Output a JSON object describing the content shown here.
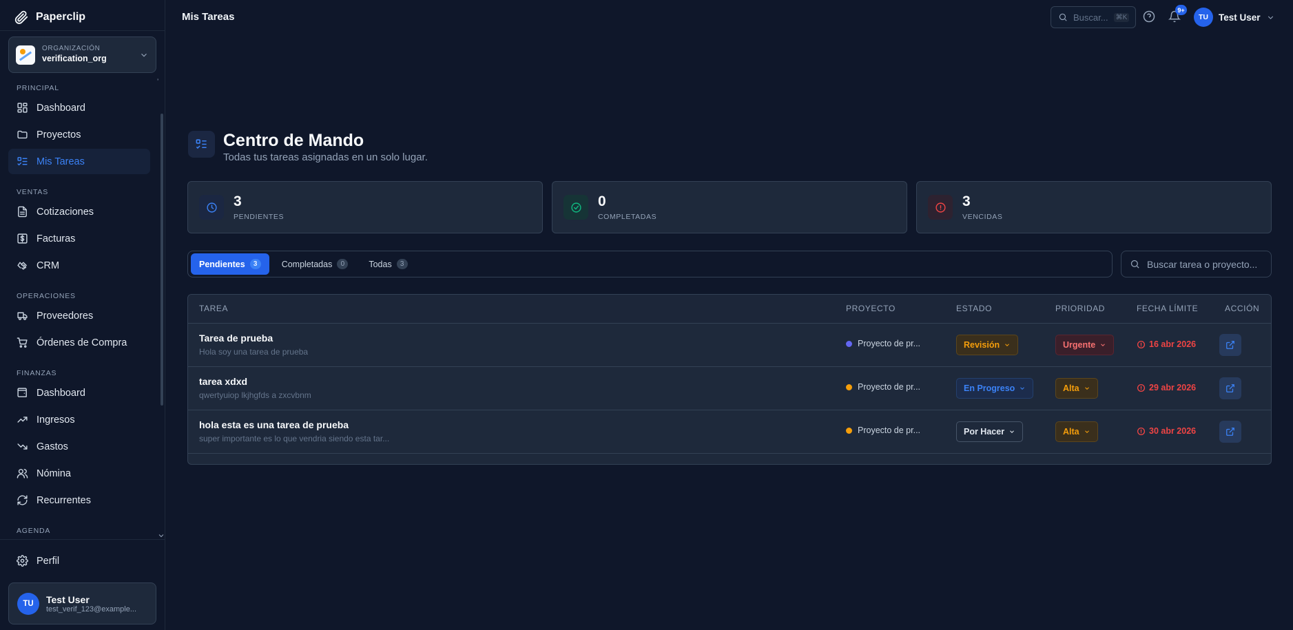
{
  "app": {
    "name": "Paperclip"
  },
  "org": {
    "label": "ORGANIZACIÓN",
    "name": "verification_org"
  },
  "sidebar": {
    "sections": [
      {
        "title": "PRINCIPAL",
        "items": [
          {
            "label": "Dashboard",
            "icon": "dashboard-icon"
          },
          {
            "label": "Proyectos",
            "icon": "folder-icon"
          },
          {
            "label": "Mis Tareas",
            "icon": "tasks-icon",
            "active": true
          }
        ]
      },
      {
        "title": "VENTAS",
        "items": [
          {
            "label": "Cotizaciones",
            "icon": "document-icon"
          },
          {
            "label": "Facturas",
            "icon": "dollar-icon"
          },
          {
            "label": "CRM",
            "icon": "handshake-icon"
          }
        ]
      },
      {
        "title": "OPERACIONES",
        "items": [
          {
            "label": "Proveedores",
            "icon": "truck-icon"
          },
          {
            "label": "Órdenes de Compra",
            "icon": "cart-icon"
          }
        ]
      },
      {
        "title": "FINANZAS",
        "items": [
          {
            "label": "Dashboard",
            "icon": "wallet-icon"
          },
          {
            "label": "Ingresos",
            "icon": "trend-up-icon"
          },
          {
            "label": "Gastos",
            "icon": "trend-down-icon"
          },
          {
            "label": "Nómina",
            "icon": "users-icon"
          },
          {
            "label": "Recurrentes",
            "icon": "refresh-icon"
          }
        ]
      },
      {
        "title": "AGENDA",
        "items": []
      }
    ],
    "perfil": "Perfil",
    "user": {
      "initials": "TU",
      "name": "Test User",
      "email": "test_verif_123@example..."
    }
  },
  "topbar": {
    "title": "Mis Tareas",
    "search_placeholder": "Buscar...",
    "shortcut": "⌘K",
    "notifications_badge": "9+",
    "user": {
      "initials": "TU",
      "name": "Test User"
    }
  },
  "page": {
    "title": "Centro de Mando",
    "subtitle": "Todas tus tareas asignadas en un solo lugar."
  },
  "stats": [
    {
      "value": "3",
      "label": "PENDIENTES",
      "icon": "clock-icon",
      "color": "#3b82f6",
      "bg": "#1b2742"
    },
    {
      "value": "0",
      "label": "COMPLETADAS",
      "icon": "check-circle-icon",
      "color": "#10b981",
      "bg": "#163436"
    },
    {
      "value": "3",
      "label": "VENCIDAS",
      "icon": "alert-circle-icon",
      "color": "#ef4444",
      "bg": "#2d2230"
    }
  ],
  "tabs": [
    {
      "label": "Pendientes",
      "count": "3",
      "active": true
    },
    {
      "label": "Completadas",
      "count": "0"
    },
    {
      "label": "Todas",
      "count": "3"
    }
  ],
  "task_search_placeholder": "Buscar tarea o proyecto...",
  "table": {
    "headers": {
      "task": "TAREA",
      "project": "PROYECTO",
      "state": "ESTADO",
      "priority": "PRIORIDAD",
      "due": "FECHA LÍMITE",
      "action": "ACCIÓN"
    },
    "rows": [
      {
        "name": "Tarea de prueba",
        "desc": "Hola soy una tarea de prueba",
        "project": "Proyecto de pr...",
        "project_color": "#6366f1",
        "state": "Revisión",
        "state_style": "amber",
        "priority": "Urgente",
        "priority_style": "red",
        "due": "16 abr 2026"
      },
      {
        "name": "tarea xdxd",
        "desc": "qwertyuiop lkjhgfds a zxcvbnm",
        "project": "Proyecto de pr...",
        "project_color": "#f59e0b",
        "state": "En Progreso",
        "state_style": "blue",
        "priority": "Alta",
        "priority_style": "amber",
        "due": "29 abr 2026"
      },
      {
        "name": "hola esta es una tarea de prueba",
        "desc": "super importante es lo que vendria siendo esta tar...",
        "project": "Proyecto de pr...",
        "project_color": "#f59e0b",
        "state": "Por Hacer",
        "state_style": "gray",
        "priority": "Alta",
        "priority_style": "amber",
        "due": "30 abr 2026"
      }
    ]
  },
  "colors": {
    "accent": "#2563eb",
    "danger": "#ef4444",
    "warning": "#f59e0b",
    "success": "#10b981"
  }
}
